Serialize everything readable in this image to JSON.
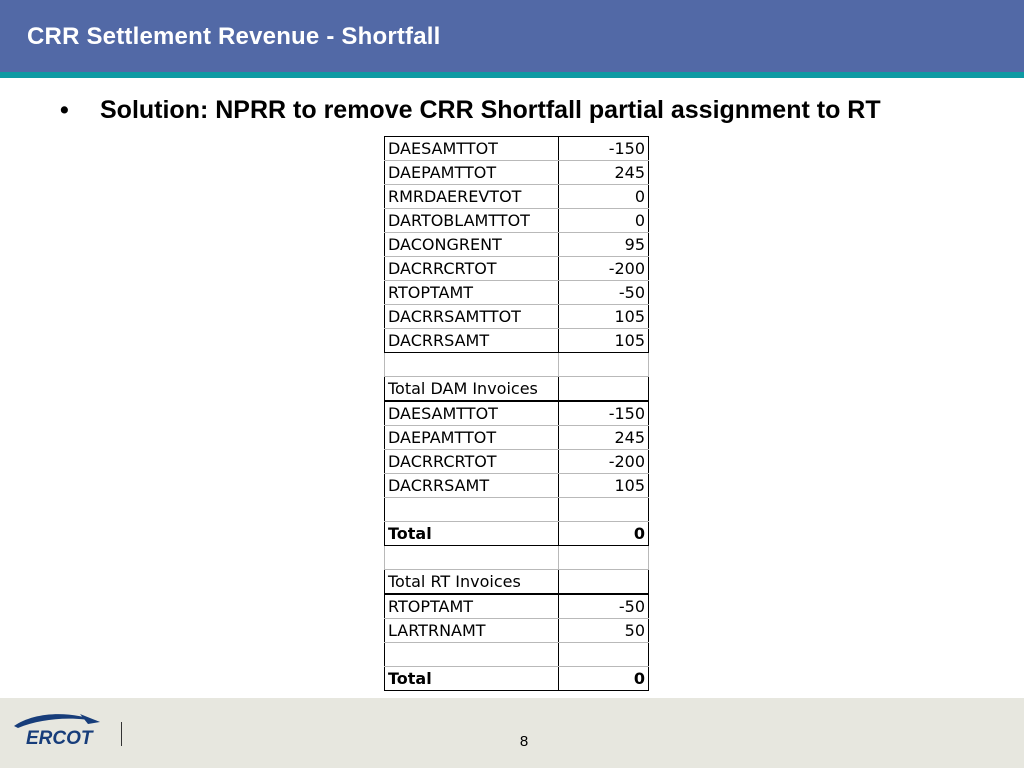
{
  "slide": {
    "title": "CRR Settlement Revenue - Shortfall",
    "bullet_symbol": "•",
    "bullet_text": "Solution: NPRR to remove CRR Shortfall partial assignment to RT",
    "page_number": "8"
  },
  "logo": {
    "text": "ERCOT",
    "icon": "ercot-logo"
  },
  "colors": {
    "header": "#5269a6",
    "header_rule": "#0e9aa3",
    "footer": "#e7e7df",
    "logo_blue": "#173d7a"
  },
  "table": {
    "rows": [
      {
        "label": "DAESAMTTOT",
        "value": "-150"
      },
      {
        "label": "DAEPAMTTOT",
        "value": "245"
      },
      {
        "label": "RMRDAEREVTOT",
        "value": "0"
      },
      {
        "label": "DARTOBLAMTTOT",
        "value": "0"
      },
      {
        "label": "DACONGRENT",
        "value": "95"
      },
      {
        "label": "DACRRCRTOT",
        "value": "-200"
      },
      {
        "label": "RTOPTAMT",
        "value": "-50"
      },
      {
        "label": "DACRRSAMTTOT",
        "value": "105"
      },
      {
        "label": "DACRRSAMT",
        "value": "105"
      },
      {
        "label": "",
        "value": ""
      },
      {
        "label": "Total DAM Invoices",
        "value": ""
      },
      {
        "label": "DAESAMTTOT",
        "value": "-150"
      },
      {
        "label": "DAEPAMTTOT",
        "value": "245"
      },
      {
        "label": "DACRRCRTOT",
        "value": "-200"
      },
      {
        "label": "DACRRSAMT",
        "value": "105"
      },
      {
        "label": "",
        "value": ""
      },
      {
        "label": "Total",
        "value": "0"
      },
      {
        "label": "",
        "value": ""
      },
      {
        "label": "Total RT Invoices",
        "value": ""
      },
      {
        "label": "RTOPTAMT",
        "value": "-50"
      },
      {
        "label": "LARTRNAMT",
        "value": "50"
      },
      {
        "label": "",
        "value": ""
      },
      {
        "label": "Total",
        "value": "0"
      }
    ]
  }
}
